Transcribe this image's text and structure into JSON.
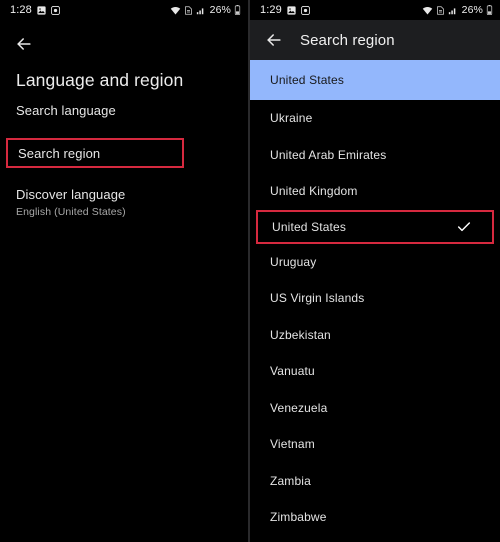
{
  "left_panel": {
    "status_bar": {
      "time": "1:28",
      "icons": [
        "image-icon",
        "camera-icon"
      ],
      "network_icons": [
        "wifi-icon",
        "sim-icon",
        "signal-icon"
      ],
      "battery_percent": "26%",
      "battery_icon": "battery-icon"
    },
    "back_icon": "back-arrow-icon",
    "title": "Language and region",
    "items": [
      {
        "label": "Search language"
      },
      {
        "label": "Search region",
        "highlighted_box": true
      },
      {
        "label": "Discover language",
        "subtitle": "English (United States)"
      }
    ],
    "annotation_color": "#d6293f"
  },
  "right_panel": {
    "status_bar": {
      "time": "1:29",
      "icons": [
        "image-icon",
        "camera-icon"
      ],
      "network_icons": [
        "wifi-icon",
        "sim-icon",
        "signal-icon"
      ],
      "battery_percent": "26%",
      "battery_icon": "battery-icon"
    },
    "back_icon": "back-arrow-icon",
    "title": "Search region",
    "highlight_color": "#93b7fc",
    "annotation_color": "#d6293f",
    "regions": [
      {
        "label": "United States",
        "highlighted": true,
        "selected": false,
        "boxed": false
      },
      {
        "label": "Ukraine",
        "highlighted": false,
        "selected": false,
        "boxed": false
      },
      {
        "label": "United Arab Emirates",
        "highlighted": false,
        "selected": false,
        "boxed": false
      },
      {
        "label": "United Kingdom",
        "highlighted": false,
        "selected": false,
        "boxed": false
      },
      {
        "label": "United States",
        "highlighted": false,
        "selected": true,
        "boxed": true
      },
      {
        "label": "Uruguay",
        "highlighted": false,
        "selected": false,
        "boxed": false
      },
      {
        "label": "US Virgin Islands",
        "highlighted": false,
        "selected": false,
        "boxed": false
      },
      {
        "label": "Uzbekistan",
        "highlighted": false,
        "selected": false,
        "boxed": false
      },
      {
        "label": "Vanuatu",
        "highlighted": false,
        "selected": false,
        "boxed": false
      },
      {
        "label": "Venezuela",
        "highlighted": false,
        "selected": false,
        "boxed": false
      },
      {
        "label": "Vietnam",
        "highlighted": false,
        "selected": false,
        "boxed": false
      },
      {
        "label": "Zambia",
        "highlighted": false,
        "selected": false,
        "boxed": false
      },
      {
        "label": "Zimbabwe",
        "highlighted": false,
        "selected": false,
        "boxed": false
      }
    ],
    "check_icon": "check-icon"
  }
}
